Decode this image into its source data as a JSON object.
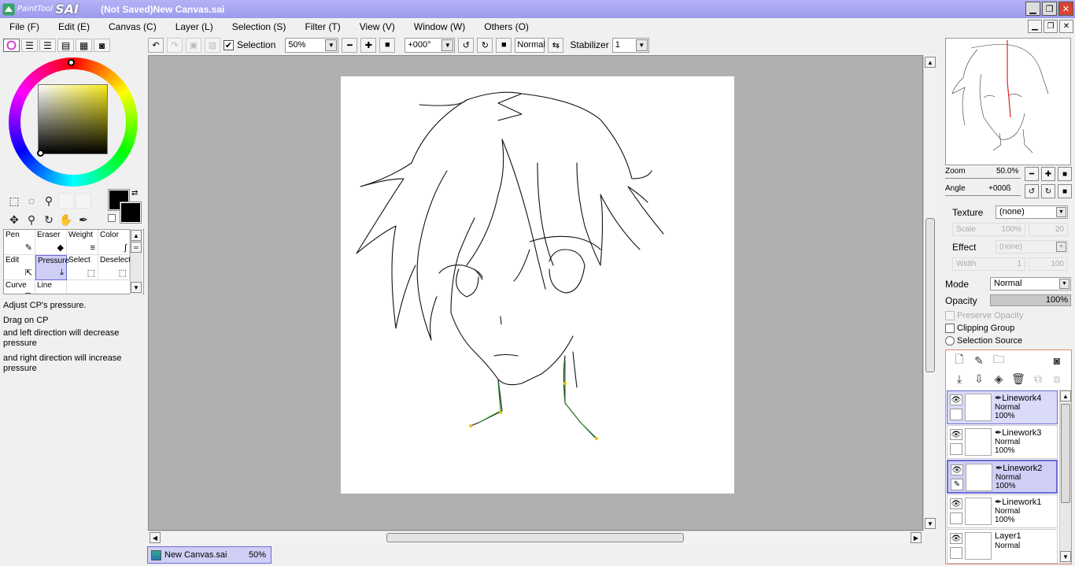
{
  "window": {
    "brand_small": "PaintTool",
    "brand_big": "SAI",
    "title": "(Not Saved)New Canvas.sai"
  },
  "menu": [
    "File (F)",
    "Edit (E)",
    "Canvas (C)",
    "Layer (L)",
    "Selection (S)",
    "Filter (T)",
    "View (V)",
    "Window (W)",
    "Others (O)"
  ],
  "toolbar": {
    "selection_label": "Selection",
    "zoom_value": "50%",
    "angle_value": "+000°",
    "blend_mode": "Normal",
    "stabilizer_label": "Stabilizer",
    "stabilizer_value": "1"
  },
  "tools": {
    "brushes": [
      {
        "label": "Pen",
        "icon": "pen-icon"
      },
      {
        "label": "Eraser",
        "icon": "eraser-icon"
      },
      {
        "label": "Weight",
        "icon": "weight-icon"
      },
      {
        "label": "Color",
        "icon": "color-curve-icon"
      },
      {
        "label": "Edit",
        "icon": "edit-cursor-icon"
      },
      {
        "label": "Pressure",
        "icon": "pressure-icon"
      },
      {
        "label": "Select",
        "icon": "select-pen-icon"
      },
      {
        "label": "Deselect",
        "icon": "deselect-pen-icon"
      },
      {
        "label": "Curve",
        "icon": "curve-icon"
      },
      {
        "label": "Line",
        "icon": "line-icon"
      }
    ],
    "help_lines": [
      "Adjust CP's pressure.",
      "Drag on CP",
      "and left direction will decrease pressure",
      "and right direction will increase pressure"
    ]
  },
  "colors": {
    "accent": "#b4b3f6",
    "selected_bg": "#cfcff5",
    "canvas_bg": "#b0b0b0",
    "primary_color": "#000000"
  },
  "document_tab": {
    "name": "New Canvas.sai",
    "zoom": "50%"
  },
  "navigator": {
    "zoom_label": "Zoom",
    "zoom_value": "50.0%",
    "angle_label": "Angle",
    "angle_value": "+000ß"
  },
  "properties": {
    "texture_label": "Texture",
    "texture_value": "(none)",
    "scale_label": "Scale",
    "scale_value": "100%",
    "scale_right": "20",
    "effect_label": "Effect",
    "effect_value": "(none)",
    "width_label": "Width",
    "width_value": "1",
    "width_right": "100",
    "mode_label": "Mode",
    "mode_value": "Normal",
    "opacity_label": "Opacity",
    "opacity_value": "100%",
    "preserve_opacity": "Preserve Opacity",
    "clipping_group": "Clipping Group",
    "selection_source": "Selection Source"
  },
  "layers": [
    {
      "name": "Linework4",
      "mode": "Normal",
      "opacity": "100%",
      "state": "active"
    },
    {
      "name": "Linework3",
      "mode": "Normal",
      "opacity": "100%",
      "state": "normal"
    },
    {
      "name": "Linework2",
      "mode": "Normal",
      "opacity": "100%",
      "state": "current"
    },
    {
      "name": "Linework1",
      "mode": "Normal",
      "opacity": "100%",
      "state": "normal"
    },
    {
      "name": "Layer1",
      "mode": "Normal",
      "opacity": "",
      "state": "normal"
    }
  ]
}
